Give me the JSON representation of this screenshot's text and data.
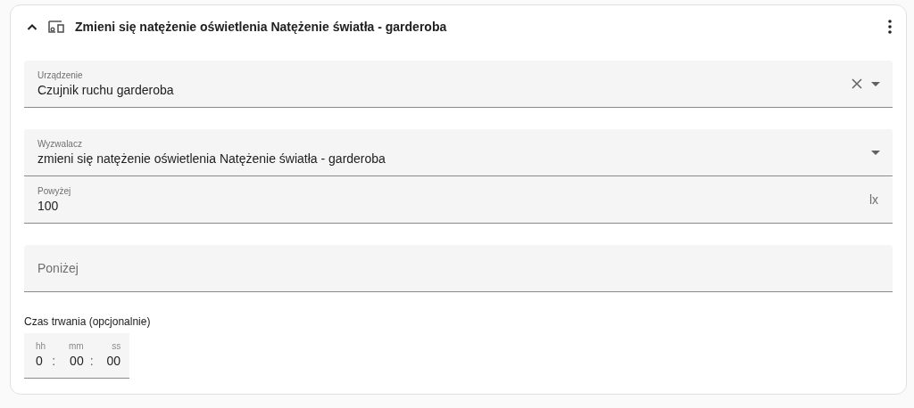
{
  "header": {
    "expanded": true,
    "title": "Zmieni się natężenie oświetlenia Natężenie światła - garderoba"
  },
  "groups": [
    [
      {
        "kind": "select",
        "label": "Urządzenie",
        "value": "Czujnik ruchu garderoba",
        "clearable": true
      }
    ],
    [
      {
        "kind": "select",
        "label": "Wyzwalacz",
        "value": "zmieni się natężenie oświetlenia Natężenie światła - garderoba",
        "clearable": false
      },
      {
        "kind": "number",
        "label": "Powyżej",
        "value": "100",
        "suffix": "lx"
      }
    ],
    [
      {
        "kind": "number",
        "placeholder": "Poniżej"
      }
    ]
  ],
  "duration": {
    "label": "Czas trwania (opcjonalnie)",
    "separator": ":",
    "units": [
      {
        "label": "hh",
        "value": "0"
      },
      {
        "label": "mm",
        "value": "00"
      },
      {
        "label": "ss",
        "value": "00"
      }
    ]
  }
}
